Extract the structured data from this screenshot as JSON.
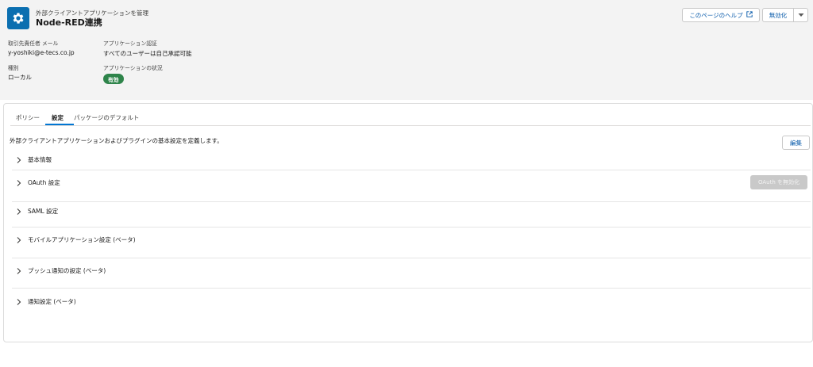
{
  "header": {
    "eyebrow": "外部クライアントアプリケーションを管理",
    "title": "Node-RED連携",
    "help_button": "このページのヘルプ",
    "deactivate_button": "無効化"
  },
  "fields": {
    "owner_email_label": "取引先責任者 メール",
    "owner_email_value": "y-yoshiki@e-tecs.co.jp",
    "app_auth_label": "アプリケーション認証",
    "app_auth_value": "すべてのユーザーは自己承認可能",
    "type_label": "種別",
    "type_value": "ローカル",
    "status_label": "アプリケーションの状況",
    "status_value": "有効"
  },
  "tabs": [
    {
      "label": "ポリシー"
    },
    {
      "label": "設定"
    },
    {
      "label": "パッケージのデフォルト"
    }
  ],
  "main": {
    "description": "外部クライアントアプリケーションおよびプラグインの基本設定を定義します。",
    "edit_button": "編集",
    "oauth_disable_button": "OAuth を無効化",
    "sections": [
      {
        "label": "基本情報"
      },
      {
        "label": "OAuth 設定"
      },
      {
        "label": "SAML 設定"
      },
      {
        "label": "モバイルアプリケーション設定 (ベータ)"
      },
      {
        "label": "プッシュ通知の設定 (ベータ)"
      },
      {
        "label": "通知設定 (ベータ)"
      }
    ]
  },
  "colors": {
    "app_icon": "#0b6fb0",
    "accent": "#0176d3",
    "status_badge": "#2e844a",
    "header_bg": "#f3f3f3"
  },
  "icons": {
    "app": "gear-icon",
    "help_external": "external-link-icon",
    "menu": "chevron-down-icon",
    "section": "chevron-right-icon"
  }
}
